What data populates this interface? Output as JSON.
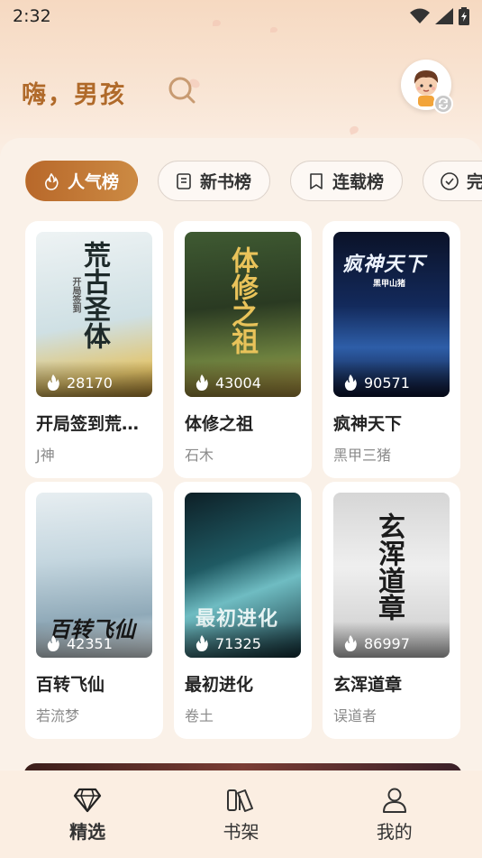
{
  "status_bar": {
    "time": "2:32"
  },
  "header": {
    "greeting": "嗨，男孩"
  },
  "tabs": [
    {
      "label": "人气榜",
      "icon": "flame-icon"
    },
    {
      "label": "新书榜",
      "icon": "book-list-icon"
    },
    {
      "label": "连载榜",
      "icon": "bookmark-icon"
    },
    {
      "label": "完",
      "icon": "check-circle-icon"
    }
  ],
  "books": [
    {
      "title": "开局签到荒…",
      "author": "J神",
      "heat": "28170",
      "cover_title": "荒古圣体",
      "cover_sub": "开局签到",
      "cover_colors": [
        "#e8eef2",
        "#b9cfd6",
        "#f1c23a"
      ]
    },
    {
      "title": "体修之祖",
      "author": "石木",
      "heat": "43004",
      "cover_title": "体修之祖",
      "cover_colors": [
        "#2b3a25",
        "#5f7a3b",
        "#c5a04c"
      ]
    },
    {
      "title": "疯神天下",
      "author": "黑甲三猪",
      "heat": "90571",
      "cover_title": "疯神天下",
      "cover_sub": "黑甲山猪",
      "cover_colors": [
        "#0b1530",
        "#1d3a7a",
        "#7aa3d9"
      ]
    },
    {
      "title": "百转飞仙",
      "author": "若流梦",
      "heat": "42351",
      "cover_title": "百转飞仙",
      "cover_colors": [
        "#dfe9ee",
        "#a9c3d2",
        "#5b7e93"
      ]
    },
    {
      "title": "最初进化",
      "author": "卷土",
      "heat": "71325",
      "cover_title": "最初进化",
      "cover_colors": [
        "#0f2a33",
        "#2f6f7a",
        "#8fcfd0"
      ]
    },
    {
      "title": "玄浑道章",
      "author": "误道者",
      "heat": "86997",
      "cover_title": "玄浑道章",
      "cover_colors": [
        "#d9d9d9",
        "#ececec",
        "#b8b8b8"
      ]
    }
  ],
  "bottom_nav": [
    {
      "label": "精选",
      "icon": "diamond-icon",
      "active": true
    },
    {
      "label": "书架",
      "icon": "bookshelf-icon",
      "active": false
    },
    {
      "label": "我的",
      "icon": "person-icon",
      "active": false
    }
  ],
  "colors": {
    "accent": "#b8682a",
    "background": "#faf1e8"
  }
}
